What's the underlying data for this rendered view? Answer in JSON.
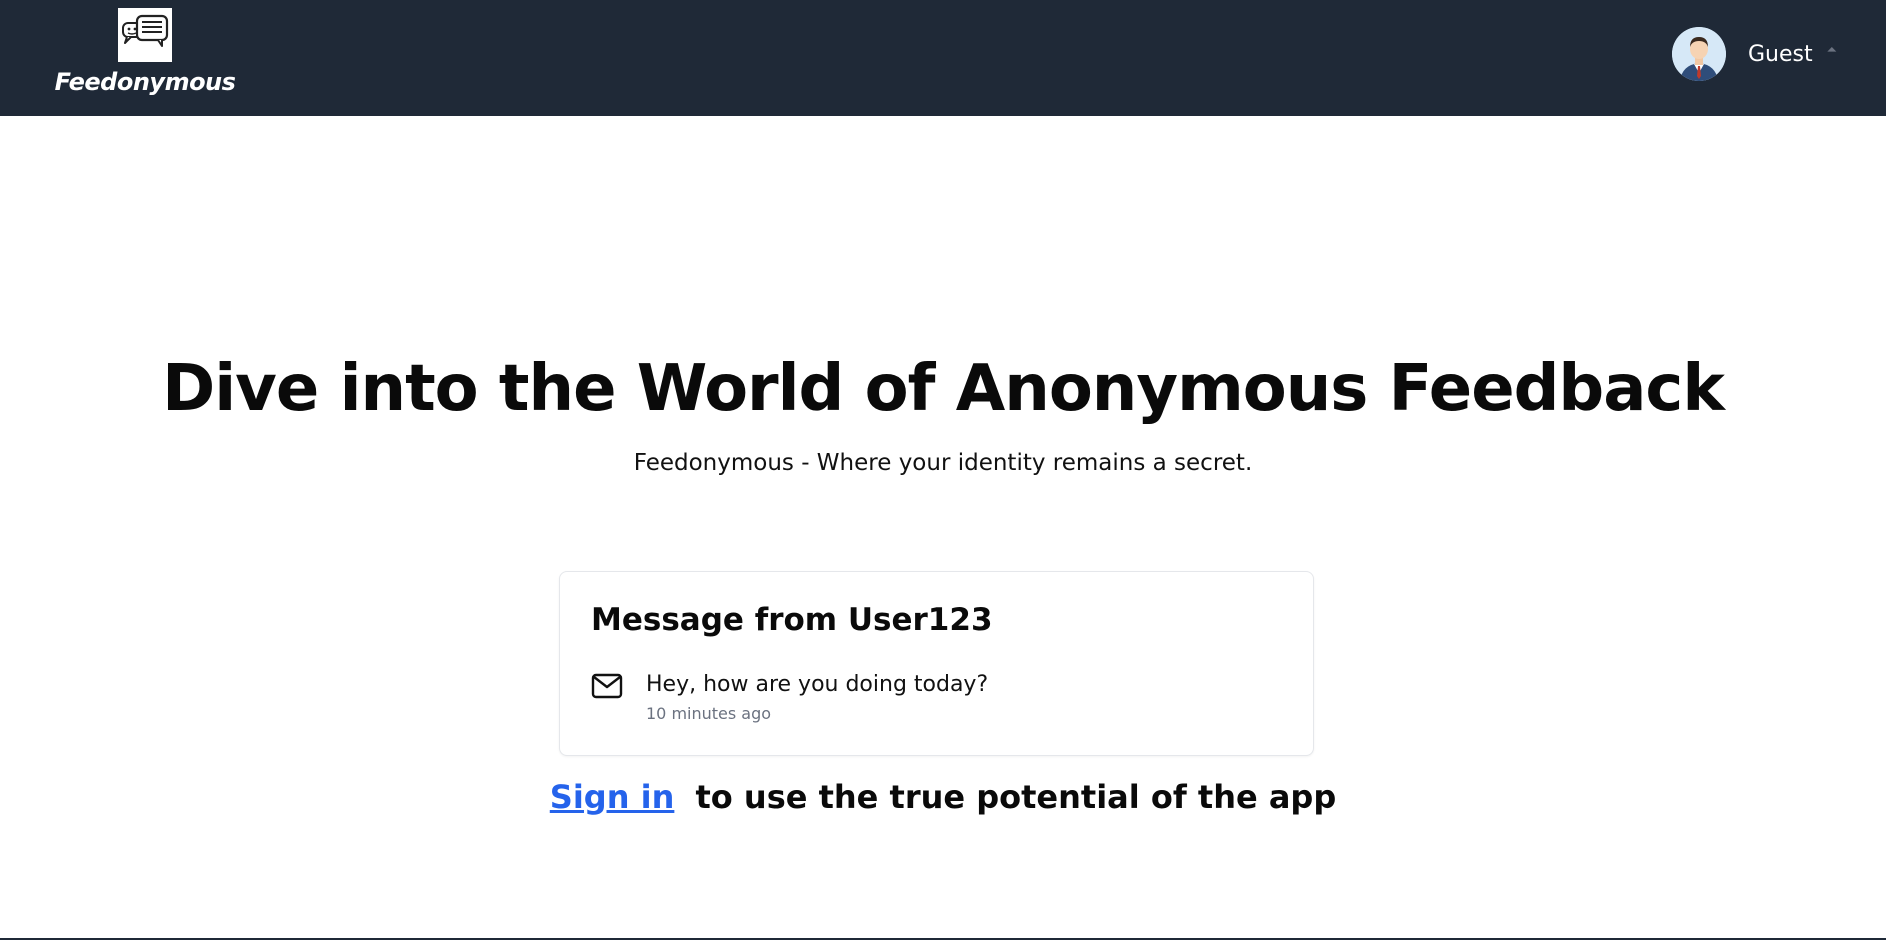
{
  "navbar": {
    "brand_name": "Feedonymous",
    "user_label": "Guest",
    "caret_glyph": "⏶"
  },
  "hero": {
    "title": "Dive into the World of Anonymous Feedback",
    "subtitle": "Feedonymous - Where your identity remains a secret."
  },
  "card": {
    "title": "Message from User123",
    "message": "Hey, how are you doing today?",
    "time": "10 minutes ago"
  },
  "cta": {
    "link_label": "Sign in",
    "text": "to use the true potential of the app"
  },
  "colors": {
    "navbar_bg": "#1f2937",
    "link": "#2563eb",
    "muted": "#6b7280"
  },
  "icons": {
    "logo": "chat-bubbles-icon",
    "avatar": "user-avatar",
    "caret": "caret-up-icon",
    "message": "mail-icon"
  }
}
